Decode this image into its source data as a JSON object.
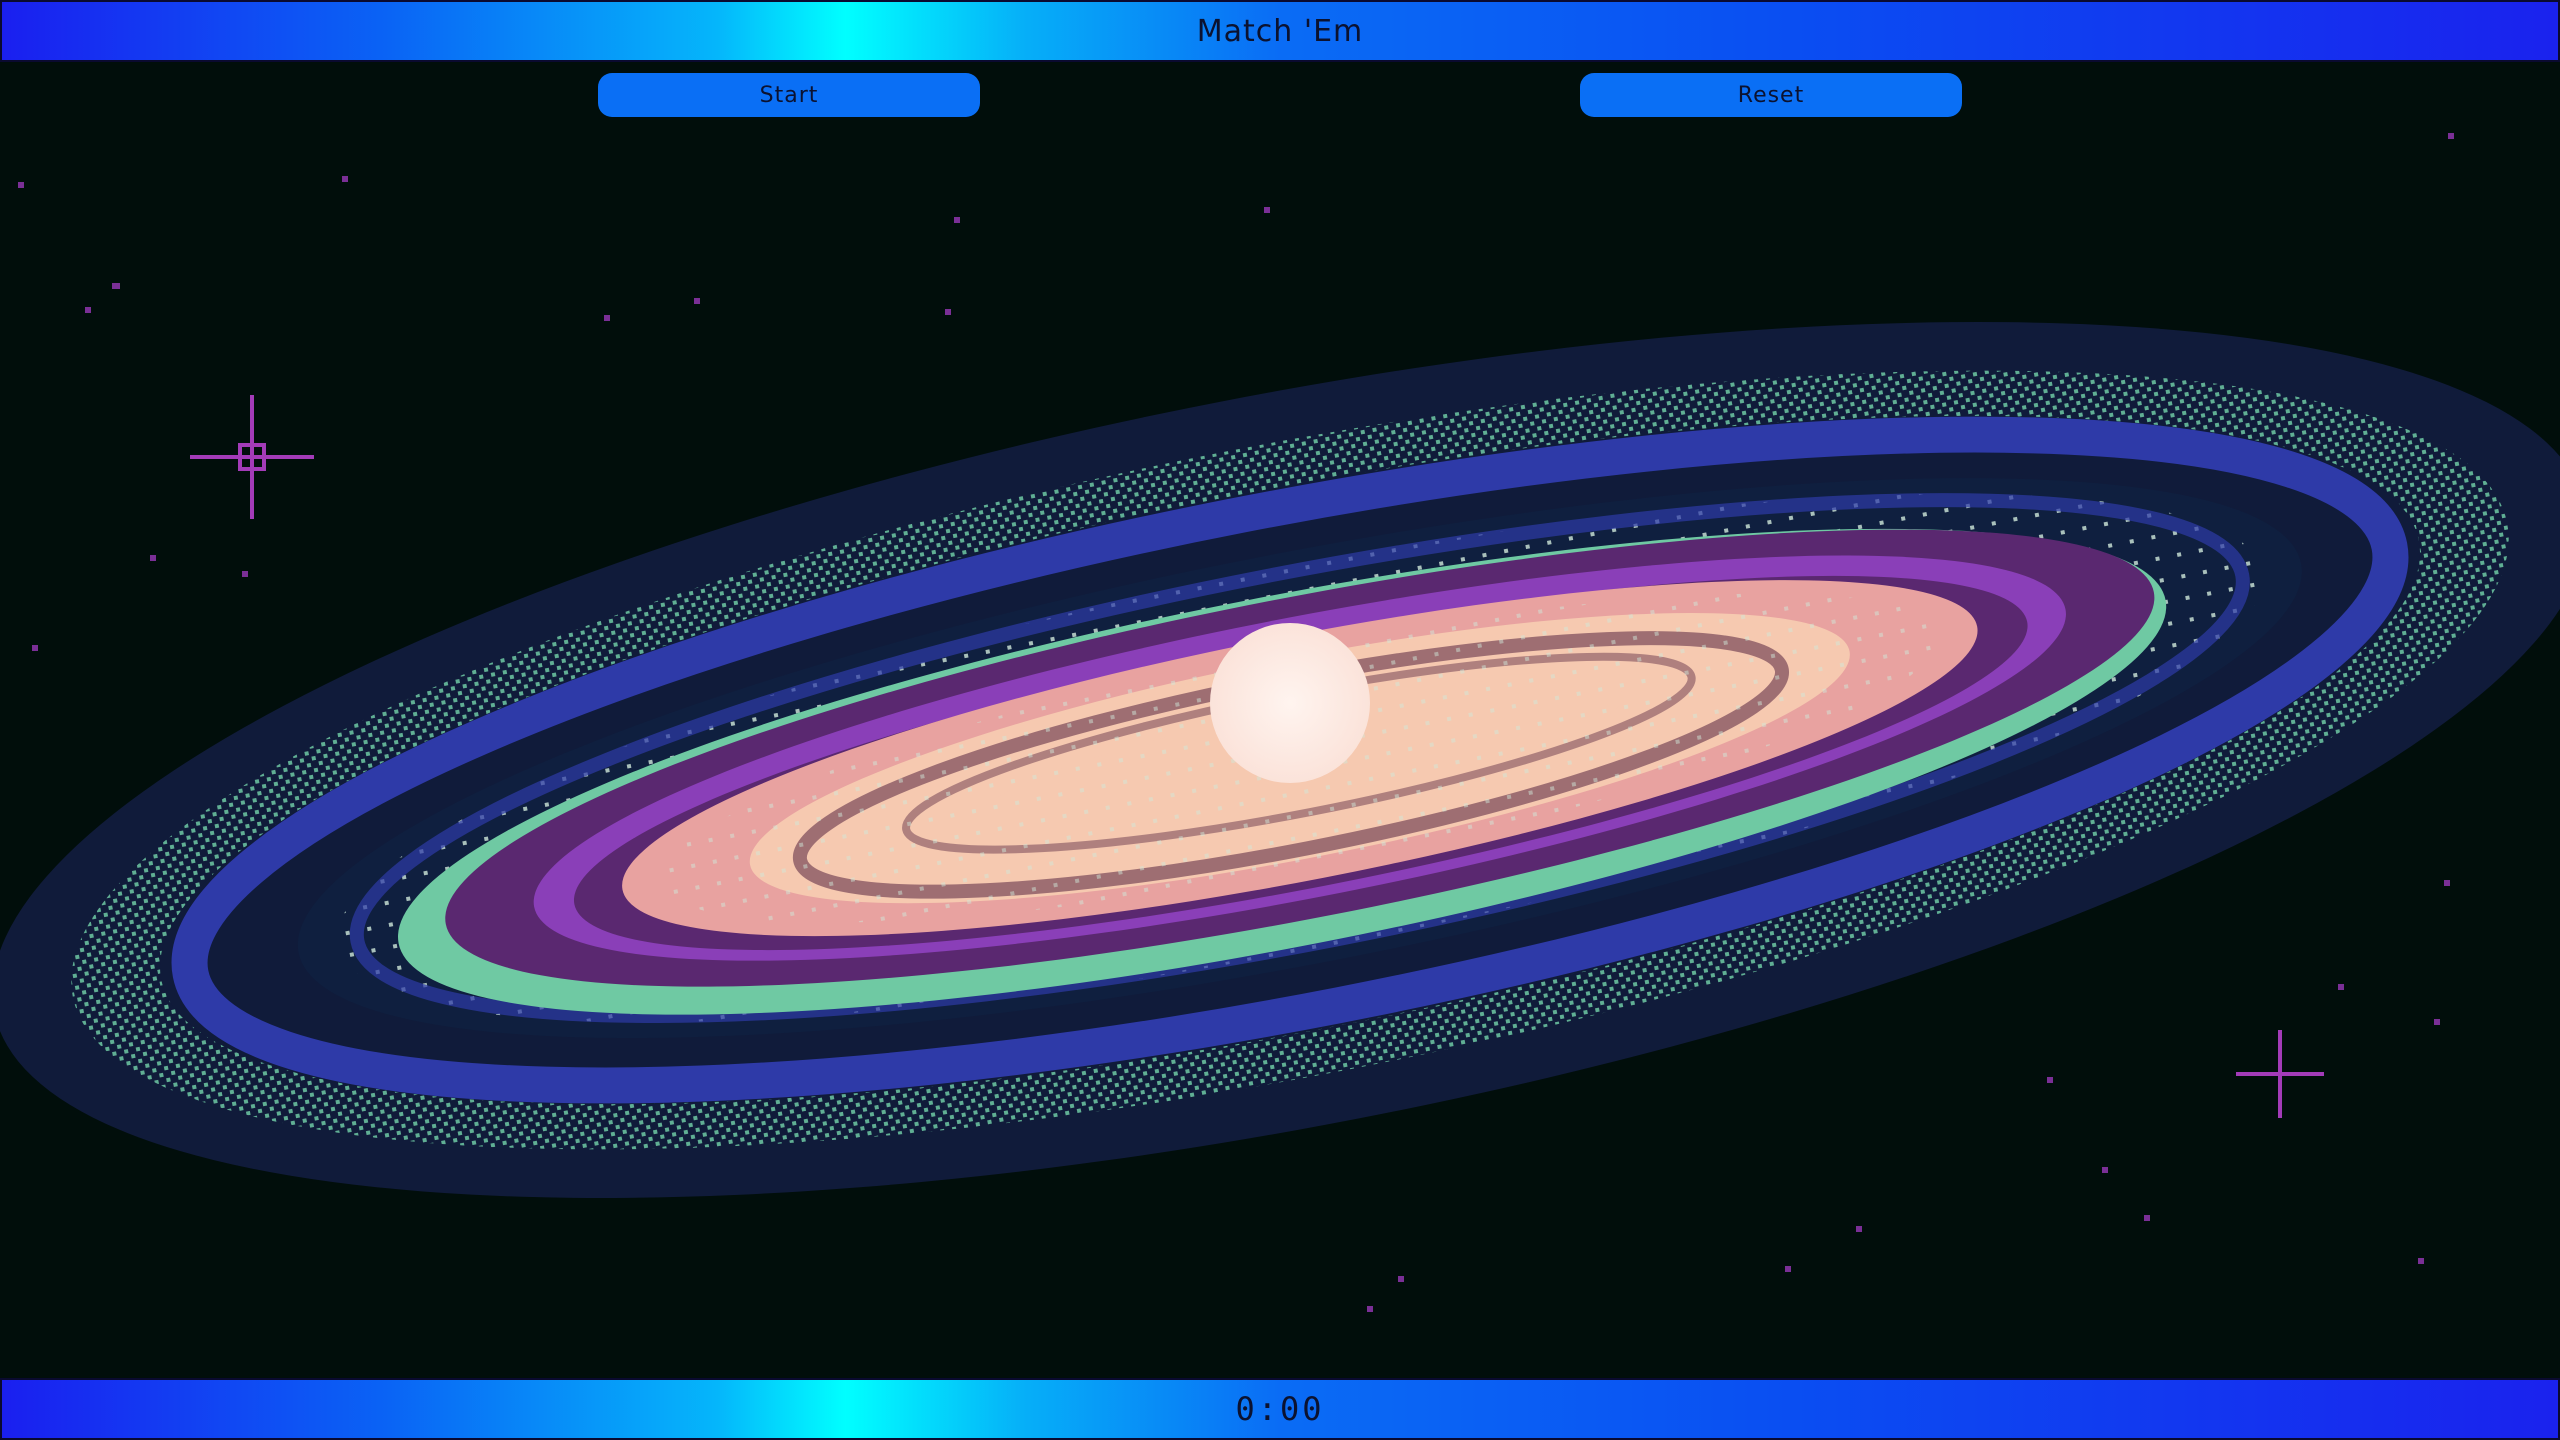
{
  "header": {
    "title": "Match 'Em"
  },
  "controls": {
    "start_label": "Start",
    "reset_label": "Reset"
  },
  "footer": {
    "timer": "0:00"
  },
  "colors": {
    "bar_blue": "#1a1ff0",
    "bar_cyan": "#00ffff",
    "button_blue": "#0a6ff5",
    "space_bg": "#010e0b",
    "galaxy_halo": "#101b3a",
    "galaxy_arm_blue": "#2e3aa8",
    "galaxy_arm_teal": "#6fc9a3",
    "galaxy_purple": "#5a2870",
    "galaxy_violet": "#8a3fb8",
    "galaxy_pink": "#e8a2a0",
    "galaxy_peach": "#f6c9b0",
    "galaxy_dust": "#9e6e72",
    "galaxy_core": "#fbe9e4",
    "star_magenta": "#a33bb8"
  },
  "icons": {
    "sparkle_left": "sparkle-star-icon",
    "sparkle_right": "sparkle-star-icon"
  }
}
